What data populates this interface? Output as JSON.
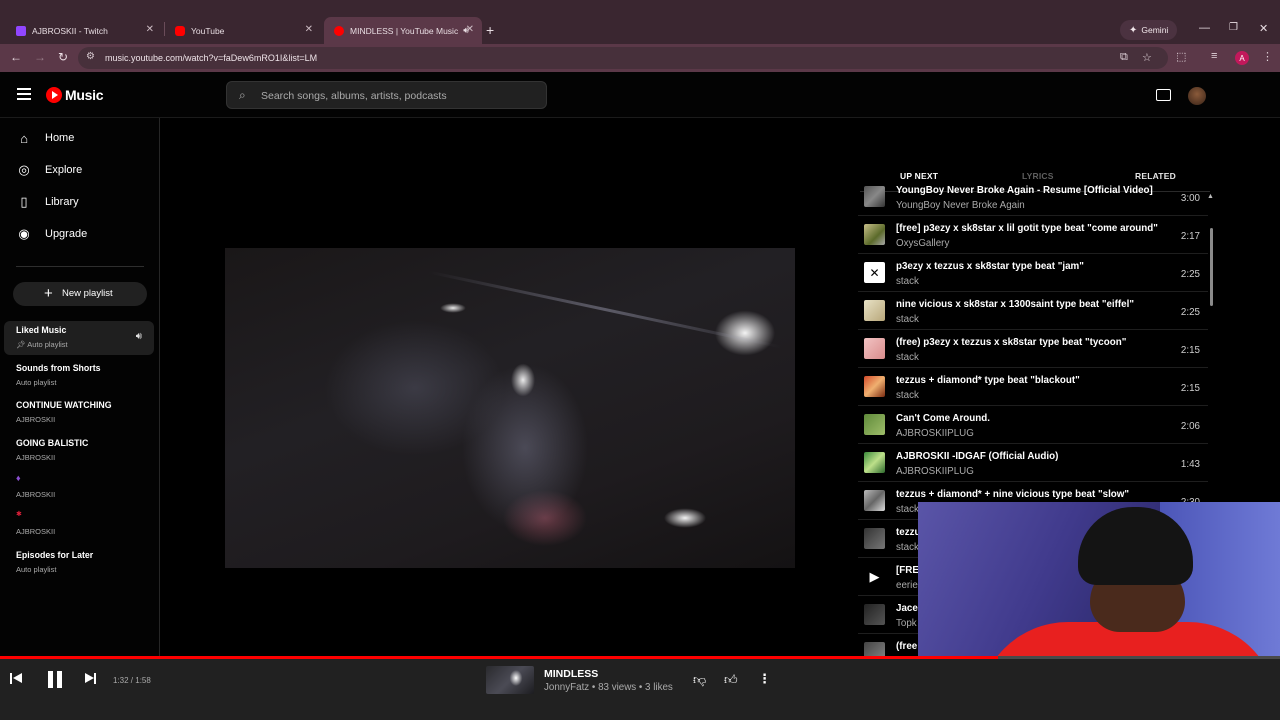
{
  "browser": {
    "tabs": [
      {
        "title": "AJBROSKII - Twitch",
        "favicon_color": "#9146ff"
      },
      {
        "title": "YouTube",
        "favicon_color": "#ff0000"
      },
      {
        "title": "MINDLESS | YouTube Music",
        "favicon_color": "#ff0000"
      }
    ],
    "gemini_label": "Gemini",
    "url": "music.youtube.com/watch?v=faDew6mRO1I&list=LM",
    "profile_initial": "A"
  },
  "header": {
    "logo_text": "Music",
    "search_placeholder": "Search songs, albums, artists, podcasts"
  },
  "sidebar": {
    "nav": [
      {
        "label": "Home",
        "icon": "home-icon"
      },
      {
        "label": "Explore",
        "icon": "explore-icon"
      },
      {
        "label": "Library",
        "icon": "library-icon"
      },
      {
        "label": "Upgrade",
        "icon": "upgrade-icon"
      }
    ],
    "new_playlist": "New playlist",
    "playlists": [
      {
        "title": "Liked Music",
        "sub": "Auto playlist"
      },
      {
        "title": "Sounds from Shorts",
        "sub": "Auto playlist"
      },
      {
        "title": "CONTINUE WATCHING",
        "sub": "AJBROSKII"
      },
      {
        "title": "GOING BALISTIC",
        "sub": "AJBROSKII"
      },
      {
        "title": "",
        "sub": "AJBROSKII"
      },
      {
        "title": "",
        "sub": "AJBROSKII"
      },
      {
        "title": "Episodes for Later",
        "sub": "Auto playlist"
      }
    ]
  },
  "queue_tabs": {
    "up_next": "UP NEXT",
    "lyrics": "LYRICS",
    "related": "RELATED"
  },
  "queue": [
    {
      "title": "YoungBoy Never Broke Again - Resume [Official Video]",
      "artist": "YoungBoy Never Broke Again",
      "duration": "3:00"
    },
    {
      "title": "[free] p3ezy x sk8star x lil gotit type beat \"come around\"",
      "artist": "OxysGallery",
      "duration": "2:17"
    },
    {
      "title": "p3ezy x tezzus x sk8star type beat \"jam\"",
      "artist": "stack",
      "duration": "2:25"
    },
    {
      "title": "nine vicious x sk8star x 1300saint type beat \"eiffel\"",
      "artist": "stack",
      "duration": "2:25"
    },
    {
      "title": "(free) p3ezy x tezzus x sk8star type beat \"tycoon\"",
      "artist": "stack",
      "duration": "2:15"
    },
    {
      "title": "tezzus + diamond* type beat \"blackout\"",
      "artist": "stack",
      "duration": "2:15"
    },
    {
      "title": "Can't Come Around.",
      "artist": "AJBROSKIIPLUG",
      "duration": "2:06"
    },
    {
      "title": "AJBROSKII -IDGAF (Official Audio)",
      "artist": "AJBROSKIIPLUG",
      "duration": "1:43"
    },
    {
      "title": "tezzus + diamond* + nine vicious type beat \"slow\"",
      "artist": "stack",
      "duration": "2:30"
    },
    {
      "title": "tezzu",
      "artist": "stack",
      "duration": ""
    },
    {
      "title": "[FRE",
      "artist": "eerie",
      "duration": ""
    },
    {
      "title": "Jace",
      "artist": "Topk",
      "duration": ""
    },
    {
      "title": "(free",
      "artist": "",
      "duration": ""
    }
  ],
  "player": {
    "time": "1:32 / 1:58",
    "progress_fraction": 0.78,
    "title": "MINDLESS",
    "subtitle": "JonnyFatz • 83 views • 3 likes"
  },
  "colors": {
    "accent": "#ff0000",
    "chrome_tab": "#5b3848"
  }
}
